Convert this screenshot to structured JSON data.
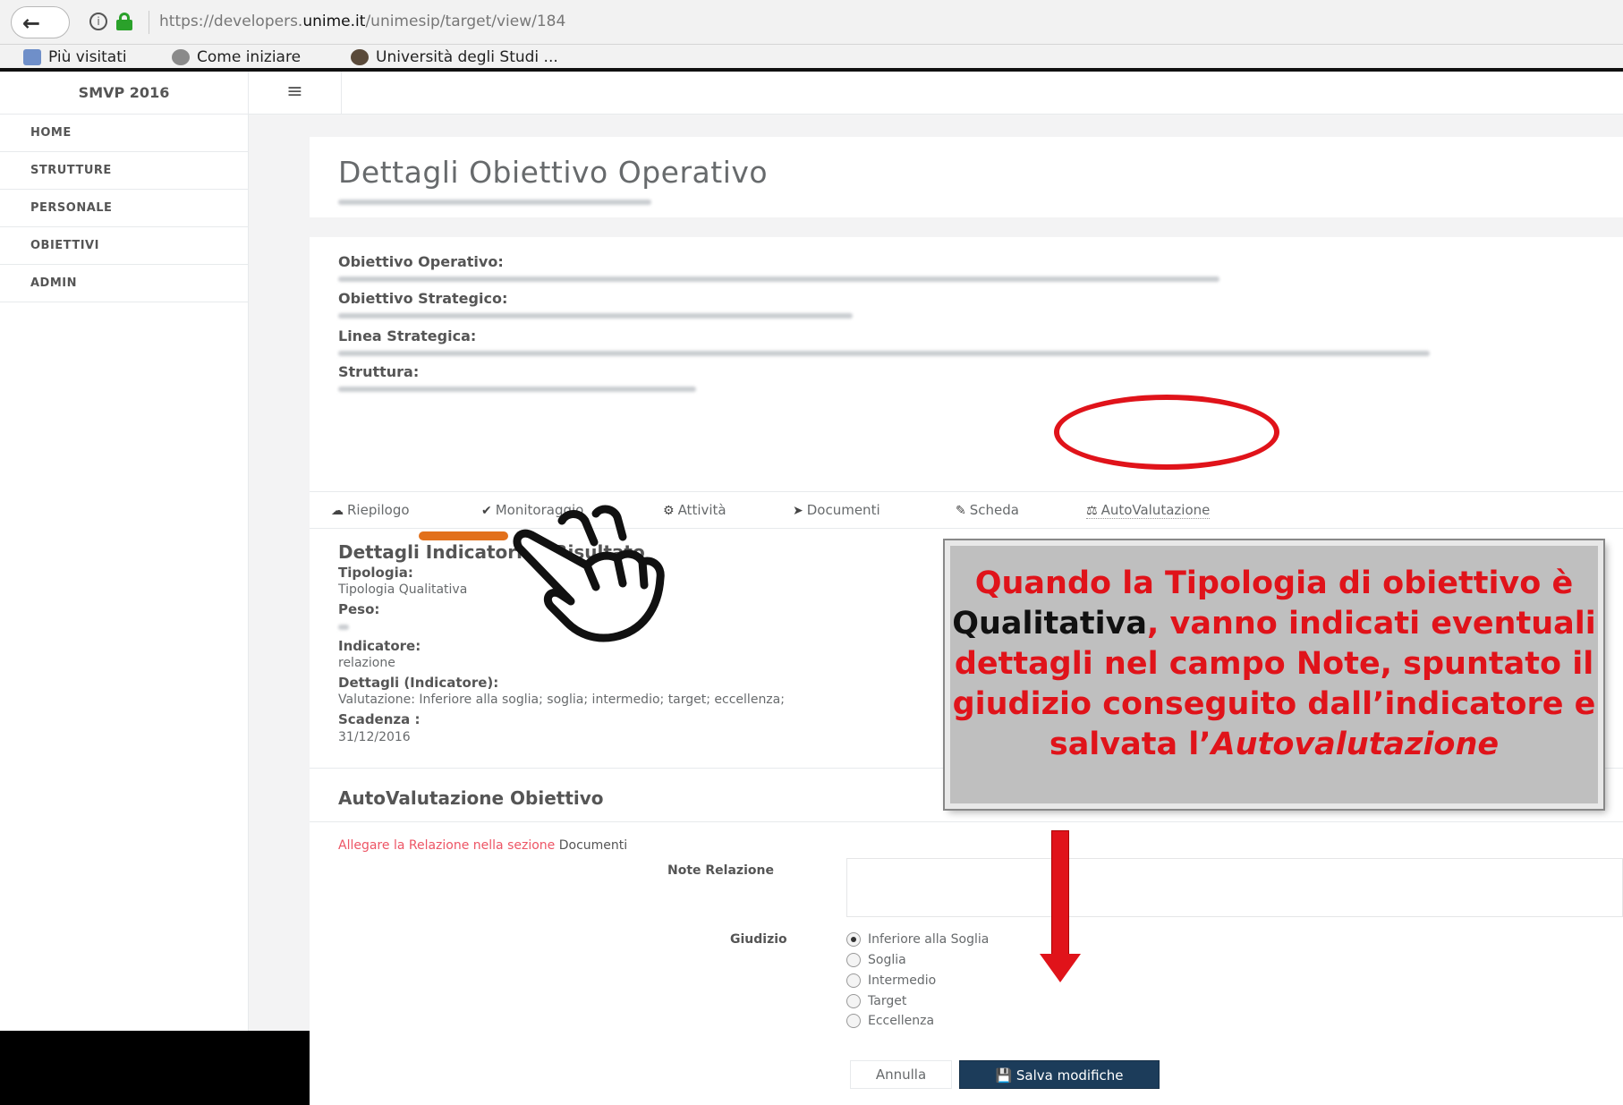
{
  "browser": {
    "url_prefix": "https://developers.",
    "url_domain": "unime.it",
    "url_path": "/unimesip/target/view/184",
    "bookmarks": [
      "Più visitati",
      "Come iniziare",
      "Università degli Studi ..."
    ]
  },
  "sidebar": {
    "brand": "SMVP 2016",
    "items": [
      "HOME",
      "STRUTTURE",
      "PERSONALE",
      "OBIETTIVI",
      "ADMIN"
    ]
  },
  "header": {
    "title": "Dettagli Obiettivo Operativo"
  },
  "info": {
    "obiettivo_operativo_label": "Obiettivo Operativo:",
    "obiettivo_strategico_label": "Obiettivo Strategico:",
    "linea_strategica_label": "Linea Strategica:",
    "struttura_label": "Struttura:"
  },
  "tabs": [
    {
      "label": "Riepilogo",
      "icon": "cloud-icon"
    },
    {
      "label": "Monitoraggio",
      "icon": "check-icon"
    },
    {
      "label": "Attività",
      "icon": "cogs-icon"
    },
    {
      "label": "Documenti",
      "icon": "send-icon"
    },
    {
      "label": "Scheda",
      "icon": "edit-icon"
    },
    {
      "label": "AutoValutazione",
      "icon": "balance-scale-icon"
    }
  ],
  "indicatori": {
    "title": "Dettagli Indicatori di Risultato",
    "tipologia_label": "Tipologia:",
    "tipologia_value": "Tipologia Qualitativa",
    "peso_label": "Peso:",
    "indicatore_label": "Indicatore:",
    "indicatore_value": "relazione",
    "dettagli_label": "Dettagli (Indicatore):",
    "dettagli_value": "Valutazione: Inferiore alla soglia; soglia; intermedio; target; eccellenza;",
    "scadenza_label": "Scadenza :",
    "scadenza_value": "31/12/2016"
  },
  "autovalutazione": {
    "title": "AutoValutazione Obiettivo",
    "attach_note": "Allegare la Relazione nella sezione",
    "attach_link": "Documenti",
    "note_label": "Note Relazione",
    "giudizio_label": "Giudizio",
    "options": [
      "Inferiore alla Soglia",
      "Soglia",
      "Intermedio",
      "Target",
      "Eccellenza"
    ],
    "selected_index": 0,
    "cancel_label": "Annulla",
    "save_label": "Salva modifiche"
  },
  "callout": {
    "part1": "Quando la Tipologia di obiettivo è",
    "part2_black": "Qualitativa",
    "part3": ", vanno indicati eventuali dettagli nel campo Note, spuntato il giudizio conseguito dall’indicatore e salvata l’",
    "part4_italic": "Autovalutazione"
  },
  "colors": {
    "annotation_red": "#e0131a",
    "underline_orange": "#e2701b",
    "save_button": "#1c3c5a",
    "attach_note_red": "#ed5565"
  }
}
